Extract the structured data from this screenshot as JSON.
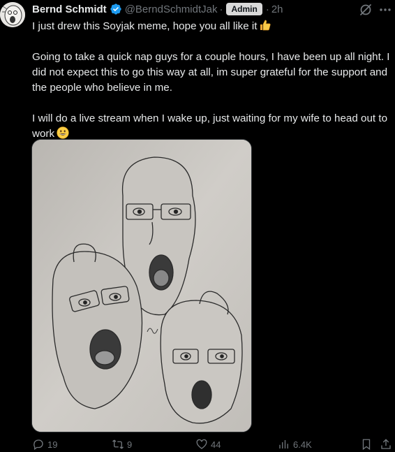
{
  "post": {
    "author": {
      "display_name": "Bernd Schmidt",
      "handle": "@BerndSchmidtJak",
      "badge": "Admin",
      "separator": "·",
      "time": "2h",
      "verified_color": "#1d9bf0"
    },
    "text": {
      "paragraph_1": "I just drew this Soyjak meme, hope you all like it",
      "paragraph_2": "Going to take a quick nap guys for a couple hours, I have been up all night. I did not expect this to go this way at all, im super grateful for the support and the people who believe in me.",
      "paragraph_3": "I will do a live stream when I wake up, just waiting for my wife to head out to work"
    },
    "emojis": {
      "thumbs_up": "thumbs-up-icon",
      "grin": "grinning-face-icon"
    },
    "stats": {
      "replies": "19",
      "reposts": "9",
      "likes": "44",
      "views": "6.4K"
    },
    "icons": {
      "grok": "grok-icon",
      "more": "more-icon",
      "reply": "reply-icon",
      "repost": "repost-icon",
      "like": "heart-icon",
      "views": "views-icon",
      "bookmark": "bookmark-icon",
      "share": "share-icon"
    },
    "colors": {
      "background": "#000000",
      "text": "#e7e9ea",
      "secondary": "#71767b",
      "badge_bg": "#d9d9d9",
      "accent": "#1d9bf0"
    }
  }
}
